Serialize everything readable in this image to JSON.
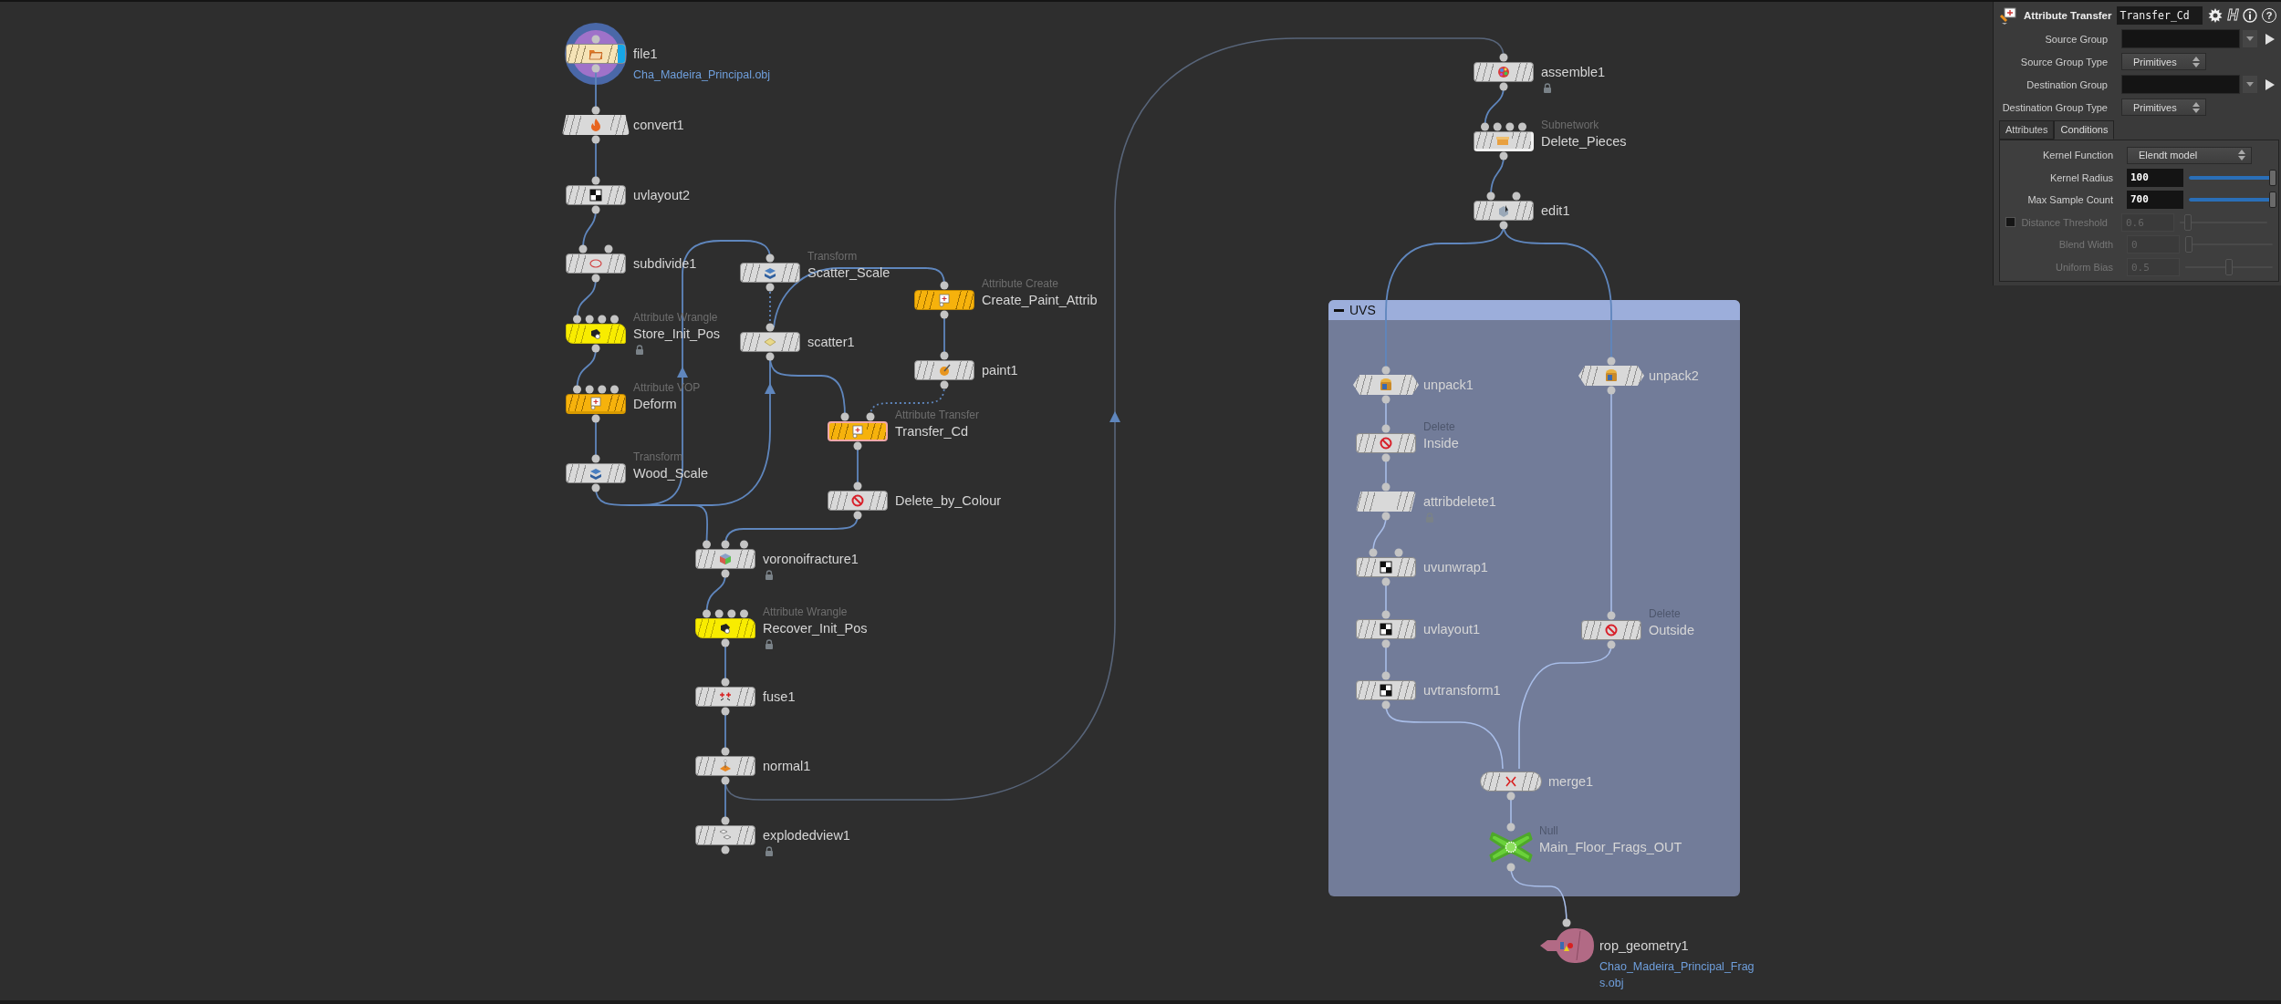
{
  "network": {
    "nodes": [
      {
        "name": "file1",
        "kind": "file",
        "path": "Cha_Madeira_Principal.obj",
        "locked": false,
        "selected": false
      },
      {
        "name": "convert1",
        "kind": "convert",
        "locked": false,
        "selected": false
      },
      {
        "name": "uvlayout2",
        "kind": "plain",
        "locked": false,
        "selected": false
      },
      {
        "name": "subdivide1",
        "kind": "plain",
        "locked": false,
        "selected": false
      },
      {
        "name": "Store_Init_Pos",
        "type": "Attribute Wrangle",
        "kind": "wrangle",
        "locked": true,
        "selected": false
      },
      {
        "name": "Deform",
        "type": "Attribute VOP",
        "kind": "vop",
        "locked": false,
        "selected": false
      },
      {
        "name": "Wood_Scale",
        "type": "Transform",
        "kind": "plain",
        "locked": false,
        "selected": false
      },
      {
        "name": "Scatter_Scale",
        "type": "Transform",
        "kind": "plain",
        "locked": false,
        "selected": false
      },
      {
        "name": "scatter1",
        "kind": "plain",
        "locked": false,
        "selected": false
      },
      {
        "name": "Create_Paint_Attrib",
        "type": "Attribute Create",
        "kind": "orange",
        "locked": false,
        "selected": false
      },
      {
        "name": "paint1",
        "kind": "plain",
        "locked": false,
        "selected": false
      },
      {
        "name": "Transfer_Cd",
        "type": "Attribute Transfer",
        "kind": "orange",
        "locked": false,
        "selected": true
      },
      {
        "name": "Delete_by_Colour",
        "kind": "plain",
        "locked": false,
        "selected": false
      },
      {
        "name": "voronoifracture1",
        "kind": "plain",
        "locked": true,
        "selected": false
      },
      {
        "name": "Recover_Init_Pos",
        "type": "Attribute Wrangle",
        "kind": "wrangle",
        "locked": true,
        "selected": false
      },
      {
        "name": "fuse1",
        "kind": "plain",
        "locked": false,
        "selected": false
      },
      {
        "name": "normal1",
        "kind": "plain",
        "locked": false,
        "selected": false
      },
      {
        "name": "explodedview1",
        "kind": "plain",
        "locked": true,
        "selected": false
      },
      {
        "name": "assemble1",
        "kind": "plain",
        "locked": true,
        "selected": false
      },
      {
        "name": "Delete_Pieces",
        "type": "Subnetwork",
        "kind": "subnet",
        "locked": false,
        "selected": false
      },
      {
        "name": "edit1",
        "kind": "plain",
        "locked": false,
        "selected": false
      },
      {
        "name": "unpack1",
        "kind": "unpack",
        "locked": false,
        "selected": false
      },
      {
        "name": "unpack2",
        "kind": "unpack",
        "locked": false,
        "selected": false
      },
      {
        "name": "Inside",
        "type": "Delete",
        "kind": "plain",
        "locked": false,
        "selected": false
      },
      {
        "name": "attribdelete1",
        "kind": "attribdelete",
        "locked": true,
        "selected": false
      },
      {
        "name": "uvunwrap1",
        "kind": "plain",
        "locked": false,
        "selected": false
      },
      {
        "name": "uvlayout1",
        "kind": "plain",
        "locked": false,
        "selected": false
      },
      {
        "name": "Outside",
        "type": "Delete",
        "kind": "plain",
        "locked": false,
        "selected": false
      },
      {
        "name": "uvtransform1",
        "kind": "plain",
        "locked": false,
        "selected": false
      },
      {
        "name": "merge1",
        "kind": "merge",
        "locked": false,
        "selected": false
      },
      {
        "name": "Main_Floor_Frags_OUT",
        "type": "Null",
        "kind": "null",
        "locked": false,
        "selected": false
      },
      {
        "name": "rop_geometry1",
        "kind": "rop",
        "path": "Chao_Madeira_Principal_Frags.obj",
        "locked": false,
        "selected": false
      }
    ],
    "network_box": {
      "title": "UVS",
      "expanded": true
    }
  },
  "parameter_panel": {
    "node_type": "Attribute Transfer",
    "node_name": "Transfer_Cd",
    "logo": "H",
    "help": "?",
    "rows": [
      {
        "kind": "group",
        "label": "Source Group"
      },
      {
        "kind": "menu",
        "label": "Source Group Type",
        "value": "Primitives"
      },
      {
        "kind": "group",
        "label": "Destination Group"
      },
      {
        "kind": "menu",
        "label": "Destination Group Type",
        "value": "Primitives"
      }
    ],
    "tabs": [
      {
        "label": "Attributes",
        "selected": false
      },
      {
        "label": "Conditions",
        "selected": true
      }
    ],
    "tab_rows": [
      {
        "kind": "menu",
        "label": "Kernel Function",
        "value": "Elendt model",
        "disabled": false
      },
      {
        "kind": "slider",
        "label": "Kernel Radius",
        "value": "100",
        "level": 1,
        "disabled": false
      },
      {
        "kind": "slider",
        "label": "Max Sample Count",
        "value": "700",
        "level": 1,
        "disabled": false
      },
      {
        "kind": "toggle_slider",
        "label": "Distance Threshold",
        "value": "0.6",
        "level": 0.06,
        "disabled": true,
        "checked": false
      },
      {
        "kind": "slider",
        "label": "Blend Width",
        "value": "0",
        "level": 0,
        "disabled": true
      },
      {
        "kind": "slider",
        "label": "Uniform Bias",
        "value": "0.5",
        "level": 0.5,
        "disabled": true
      }
    ]
  }
}
